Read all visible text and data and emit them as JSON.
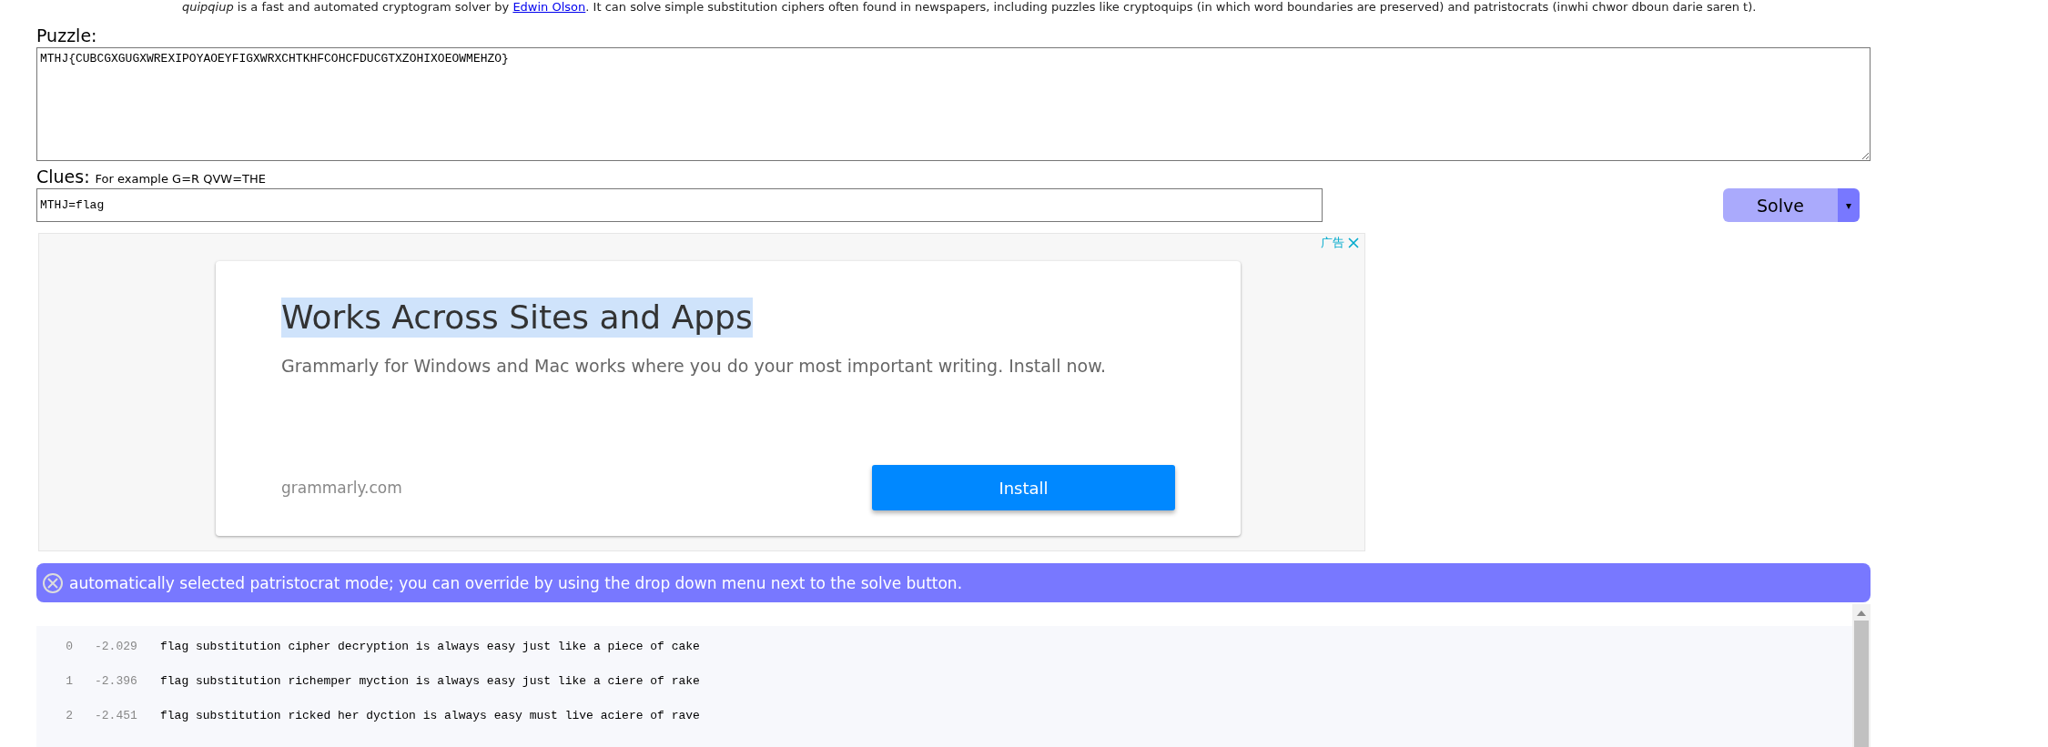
{
  "intro": {
    "text": "*quipqiup* is a fast and automated cryptogram solver by ",
    "link": "Edwin Olson",
    "after": ". It can solve simple substitution ciphers often found in newspapers, including puzzles like cryptoquips (in which word boundaries are preserved) and patristocrats (inwhi chwor dboun darie saren t)."
  },
  "puzzle": {
    "label": "Puzzle:",
    "value": "MTHJ{CUBCGXGUGXWREXIPOYAOEYFIGXWRXCHTKHFCOHCFDUCGTXZOHIXOEOWMEHZO}"
  },
  "clues": {
    "label": "Clues:",
    "hint": "For example G=R QVW=THE",
    "value": "MTHJ=flag"
  },
  "solve_button": {
    "label": "Solve",
    "dropdown": "▾"
  },
  "ad": {
    "badge": "广告",
    "headline": "Works Across Sites and Apps",
    "body": "Grammarly for Windows and Mac works where you do your most important writing. Install now.",
    "domain": "grammarly.com",
    "button": "Install"
  },
  "status": {
    "message": "automatically selected patristocrat mode; you can override by using the drop down menu next to the solve button."
  },
  "results": [
    {
      "index": "0",
      "score": "-2.029",
      "text": "flag substitution cipher decryption is always easy just like a piece of cake"
    },
    {
      "index": "1",
      "score": "-2.396",
      "text": "flag substitution richemper myction is always easy just like a ciere of rake"
    },
    {
      "index": "2",
      "score": "-2.451",
      "text": "flag substitution ricked her dyction is always easy must live aciere of rave"
    }
  ]
}
